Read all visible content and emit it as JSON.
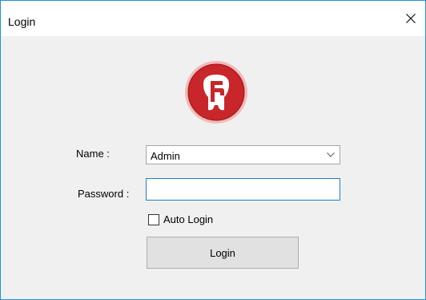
{
  "window": {
    "title": "Login"
  },
  "form": {
    "name_label": "Name :",
    "name_value": "Admin",
    "password_label": "Password :",
    "password_value": "",
    "auto_login_label": "Auto Login",
    "auto_login_checked": false,
    "login_button": "Login"
  },
  "colors": {
    "logo_red": "#c8262a",
    "window_border": "#1e90d8",
    "focus_border": "#1e7fcf"
  },
  "icons": {
    "close": "close-icon",
    "dropdown": "chevron-down-icon",
    "logo": "app-logo"
  }
}
